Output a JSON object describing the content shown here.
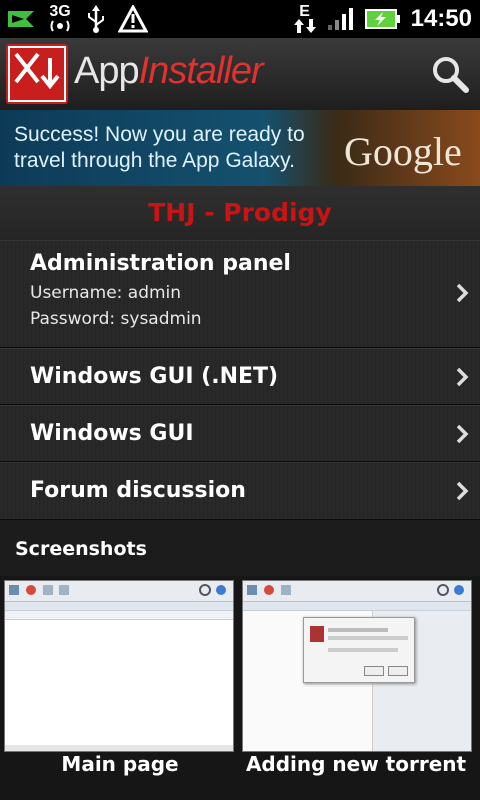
{
  "status_bar": {
    "network_label": "3G",
    "data_label": "E",
    "time": "14:50",
    "icons": [
      "notification-flag-icon",
      "wifi-hotspot-icon",
      "usb-icon",
      "warning-icon",
      "signal-icon",
      "battery-charging-icon"
    ]
  },
  "app": {
    "title_part1": "App",
    "title_part2": "Installer",
    "icons": [
      "app-logo-icon",
      "search-icon"
    ]
  },
  "banner": {
    "text": "Success! Now you are ready to travel through the App Galaxy.",
    "brand": "Google"
  },
  "page_title": "THJ - Prodigy",
  "list": {
    "items": [
      {
        "label": "Administration panel",
        "line1": "Username: admin",
        "line2": "Password: sysadmin"
      },
      {
        "label": "Windows GUI (.NET)"
      },
      {
        "label": "Windows GUI"
      },
      {
        "label": "Forum discussion"
      }
    ]
  },
  "screenshots": {
    "heading": "Screenshots",
    "items": [
      {
        "caption": "Main page"
      },
      {
        "caption": "Adding new torrent"
      }
    ]
  },
  "colors": {
    "accent_red": "#c81414",
    "background": "#1b1b1b",
    "status_bar": "#000000"
  }
}
